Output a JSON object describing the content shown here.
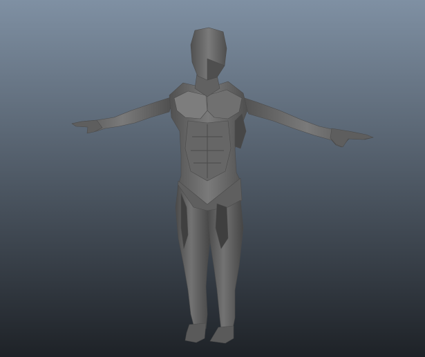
{
  "viewport": {
    "gradient_top": "#7f90a3",
    "gradient_bottom": "#1e2227"
  },
  "model": {
    "kind": "low-poly human anatomy mesh, T-pose",
    "base_color": "#6b6b6b",
    "light_color": "#8a8a8a",
    "shadow_color": "#3d3d3d",
    "edge_color": "#4a4a4a"
  }
}
